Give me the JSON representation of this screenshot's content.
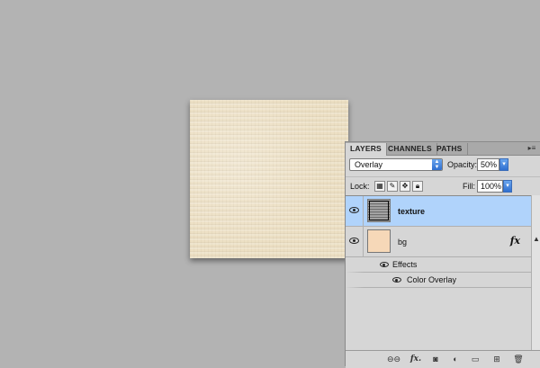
{
  "panel": {
    "tabs": [
      {
        "label": "LAYERS",
        "active": true
      },
      {
        "label": "CHANNELS",
        "active": false
      },
      {
        "label": "PATHS",
        "active": false
      }
    ],
    "menu_icon": "panel-menu-icon",
    "blend_mode": "Overlay",
    "opacity_label": "Opacity:",
    "opacity_value": "50%",
    "lock_label": "Lock:",
    "fill_label": "Fill:",
    "fill_value": "100%",
    "layers": [
      {
        "name": "texture",
        "selected": true,
        "visible": true
      },
      {
        "name": "bg",
        "selected": false,
        "visible": true,
        "fx": "fx",
        "effects_label": "Effects",
        "effects": [
          "Color Overlay"
        ]
      }
    ],
    "bottom_icons": [
      "link-icon",
      "fx-icon",
      "mask-icon",
      "adjustment-icon",
      "group-icon",
      "new-layer-icon",
      "trash-icon"
    ],
    "bottom_fx_text": "fx."
  },
  "colors": {
    "workspace": "#b3b3b3",
    "selected_layer": "#b0d3fb",
    "canvas_texture": "#ecdfc3",
    "bg_thumb": "#f6d8b8"
  }
}
